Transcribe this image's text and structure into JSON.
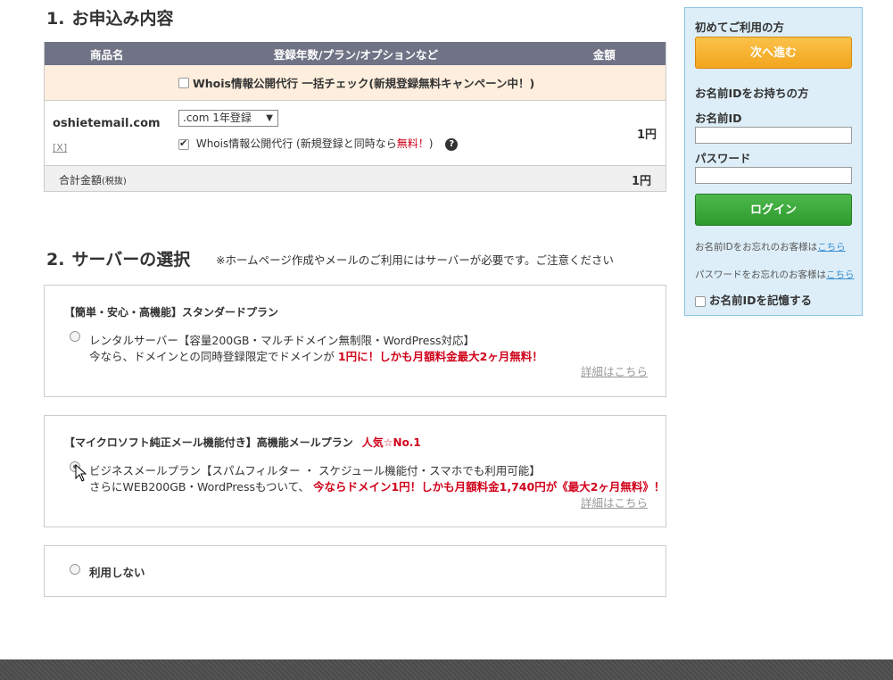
{
  "section1": {
    "num": "1.",
    "title": "お申込み内容"
  },
  "order_table": {
    "headers": [
      "商品名",
      "登録年数/プラン/オプションなど",
      "金額"
    ],
    "campaign_label": "Whois情報公開代行 一括チェック(新規登録無料キャンペーン中！)",
    "domain": "oshietemail.com",
    "remove_label": "[X]",
    "term_select": ".com 1年登録",
    "whois_prefix": "Whois情報公開代行 (新規登録と同時なら",
    "whois_free": "無料！",
    "whois_suffix": ")",
    "price": "1円",
    "total_label": "合計金額",
    "total_tax": "(税抜)",
    "total_price": "1円"
  },
  "section2": {
    "num": "2.",
    "title": "サーバーの選択",
    "note": "※ホームページ作成やメールのご利用にはサーバーが必要です。ご注意ください"
  },
  "plans": [
    {
      "title": "【簡単・安心・高機能】スタンダードプラン",
      "line1": "レンタルサーバー【容量200GB・マルチドメイン無制限・WordPress対応】",
      "line2_prefix": "今なら、ドメインとの同時登録限定でドメインが",
      "line2_hl": "1円に！しかも月額料金最大2ヶ月無料！",
      "detail": "詳細はこちら"
    },
    {
      "title": "【マイクロソフト純正メール機能付き】高機能メールプラン",
      "badge": "人気☆No.1",
      "line1": "ビジネスメールプラン【スパムフィルター ・ スケジュール機能付・スマホでも利用可能】",
      "line2_prefix": "さらにWEB200GB・WordPressもついて、",
      "line2_hl": "今ならドメイン1円！しかも月額料金1,740円が《最大2ヶ月無料》！",
      "detail": "詳細はこちら"
    },
    {
      "label": "利用しない"
    }
  ],
  "login": {
    "first_time": "初めてご利用の方",
    "next_button": "次へ進む",
    "have_id": "お名前IDをお持ちの方",
    "id_label": "お名前ID",
    "password_label": "パスワード",
    "login_button": "ログイン",
    "forgot_id_prefix": "お名前IDをお忘れのお客様は",
    "forgot_pw_prefix": "パスワードをお忘れのお客様は",
    "here": "こちら",
    "remember": "お名前IDを記憶する"
  }
}
